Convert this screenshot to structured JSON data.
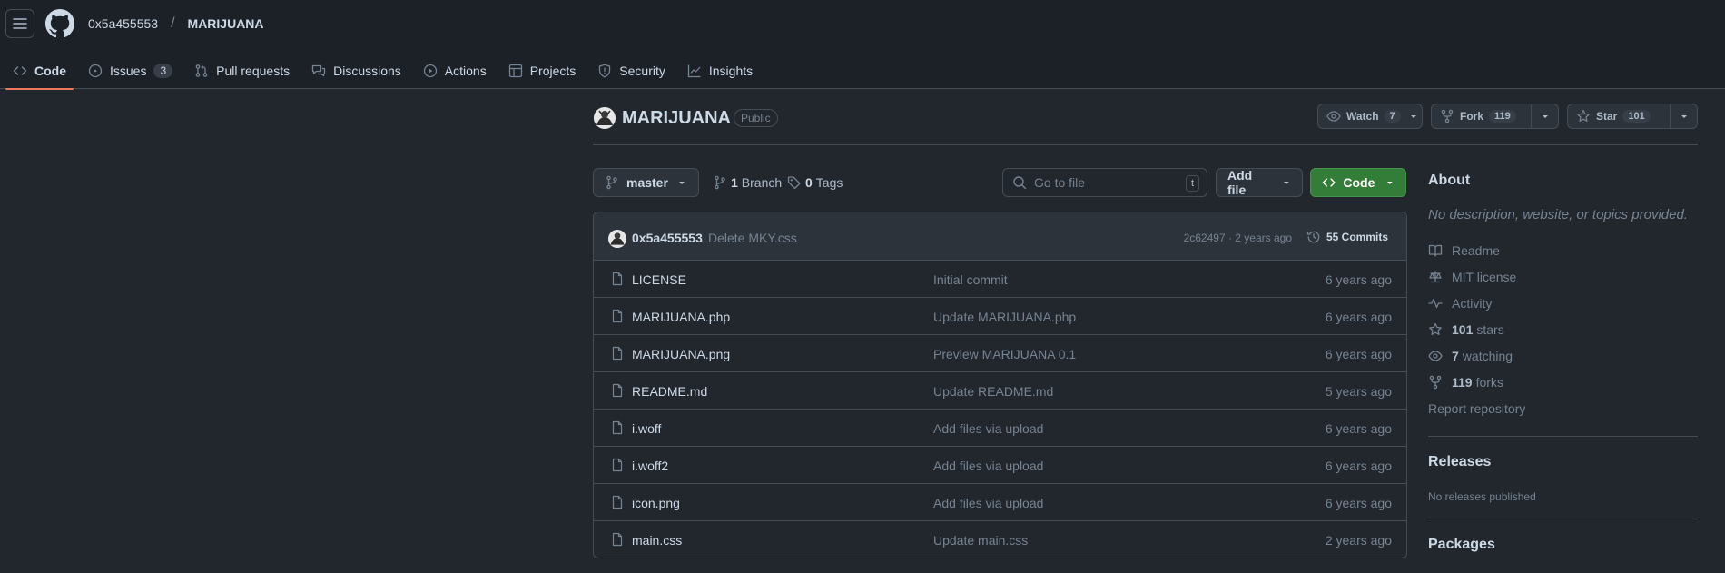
{
  "header": {
    "owner": "0x5a455553",
    "separator": "/",
    "repo": "MARIJUANA"
  },
  "tabs": [
    {
      "label": "Code",
      "icon": "code-icon",
      "active": true
    },
    {
      "label": "Issues",
      "icon": "issue-icon",
      "count": "3"
    },
    {
      "label": "Pull requests",
      "icon": "pull-request-icon"
    },
    {
      "label": "Discussions",
      "icon": "discussion-icon"
    },
    {
      "label": "Actions",
      "icon": "play-icon"
    },
    {
      "label": "Projects",
      "icon": "table-icon"
    },
    {
      "label": "Security",
      "icon": "shield-icon"
    },
    {
      "label": "Insights",
      "icon": "graph-icon"
    }
  ],
  "repo_header": {
    "name": "MARIJUANA",
    "visibility": "Public",
    "watch": {
      "label": "Watch",
      "count": "7"
    },
    "fork": {
      "label": "Fork",
      "count": "119"
    },
    "star": {
      "label": "Star",
      "count": "101"
    }
  },
  "toolbar": {
    "branch": "master",
    "branches_count": "1",
    "branches_label": "Branch",
    "tags_count": "0",
    "tags_label": "Tags",
    "search_placeholder": "Go to file",
    "search_kbd": "t",
    "add_file": "Add file",
    "code": "Code"
  },
  "latest_commit": {
    "author": "0x5a455553",
    "message": "Delete MKY.css",
    "hash_age": "2c62497 · 2 years ago",
    "commits": "55 Commits"
  },
  "files": [
    {
      "name": "LICENSE",
      "message": "Initial commit",
      "age": "6 years ago"
    },
    {
      "name": "MARIJUANA.php",
      "message": "Update MARIJUANA.php",
      "age": "6 years ago"
    },
    {
      "name": "MARIJUANA.png",
      "message": "Preview MARIJUANA 0.1",
      "age": "6 years ago"
    },
    {
      "name": "README.md",
      "message": "Update README.md",
      "age": "5 years ago"
    },
    {
      "name": "i.woff",
      "message": "Add files via upload",
      "age": "6 years ago"
    },
    {
      "name": "i.woff2",
      "message": "Add files via upload",
      "age": "6 years ago"
    },
    {
      "name": "icon.png",
      "message": "Add files via upload",
      "age": "6 years ago"
    },
    {
      "name": "main.css",
      "message": "Update main.css",
      "age": "2 years ago"
    }
  ],
  "about": {
    "title": "About",
    "description": "No description, website, or topics provided.",
    "readme": "Readme",
    "license": "MIT license",
    "activity": "Activity",
    "stars_count": "101",
    "stars_label": "stars",
    "watching_count": "7",
    "watching_label": "watching",
    "forks_count": "119",
    "forks_label": "forks",
    "report": "Report repository"
  },
  "releases": {
    "title": "Releases",
    "text": "No releases published"
  },
  "packages": {
    "title": "Packages"
  },
  "colors": {
    "background": "#22272e",
    "header": "#1c2128",
    "border": "#444c56",
    "accent_tab": "#ec775c",
    "code_button": "#347d39"
  }
}
